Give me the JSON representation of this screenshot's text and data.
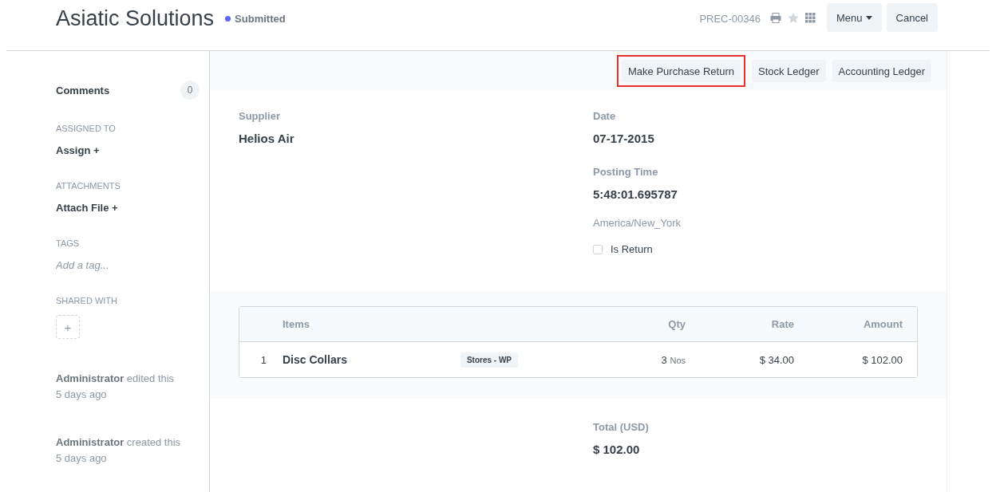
{
  "header": {
    "title": "Asiatic Solutions",
    "status": {
      "label": "Submitted",
      "color": "#5e64ff"
    },
    "doc_id": "PREC-00346",
    "buttons": [
      {
        "label": "Menu",
        "kind": "dropdown"
      },
      {
        "label": "Cancel",
        "kind": "plain"
      }
    ]
  },
  "sidebar": {
    "comments": {
      "label": "Comments",
      "count": "0"
    },
    "sections": [
      {
        "heading": "ASSIGNED TO",
        "kind": "action",
        "text": "Assign +"
      },
      {
        "heading": "ATTACHMENTS",
        "kind": "action",
        "text": "Attach File +"
      },
      {
        "heading": "TAGS",
        "kind": "placeholder",
        "placeholder": "Add a tag..."
      },
      {
        "heading": "SHARED WITH",
        "kind": "add",
        "text": "+"
      }
    ],
    "activity": [
      {
        "text": "**Administrator** edited this",
        "time": "5 days ago"
      },
      {
        "text": "**Administrator** created this",
        "time": "5 days ago"
      }
    ]
  },
  "actions": [
    {
      "label": "Make Purchase Return",
      "highlighted": true
    },
    {
      "label": "Stock Ledger",
      "highlighted": false
    },
    {
      "label": "Accounting Ledger",
      "highlighted": false
    }
  ],
  "form": {
    "left": [
      {
        "label": "Supplier",
        "value": "Helios Air"
      }
    ],
    "right": [
      {
        "label": "Date",
        "value": "07-17-2015"
      },
      {
        "label": "Posting Time",
        "value": "5:48:01.695787"
      }
    ],
    "timezone": "America/New_York",
    "is_return": {
      "label": "Is Return",
      "checked": false
    }
  },
  "table": {
    "columns": [
      "Items",
      "Qty",
      "Rate",
      "Amount"
    ],
    "rows": [
      {
        "index": "1",
        "item": "Disc Collars",
        "warehouse": "Stores - WP",
        "qty": "3",
        "uom": "Nos",
        "rate": "$ 34.00",
        "amount": "$ 102.00"
      }
    ]
  },
  "total": {
    "label": "Total (USD)",
    "value": "$ 102.00"
  }
}
